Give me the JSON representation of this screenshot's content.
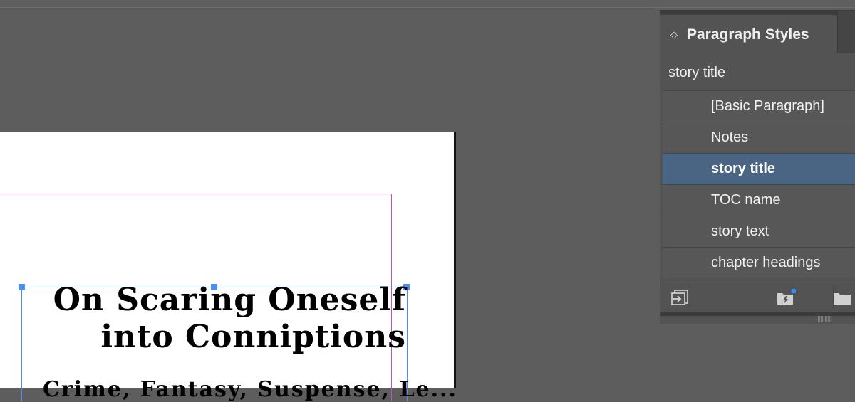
{
  "document": {
    "title_text": "On Scaring Oneself\ninto Conniptions",
    "subtitle_text": "Crime, Fantasy, Suspense, Le..."
  },
  "panel": {
    "title": "Paragraph Styles",
    "current_style": "story title",
    "styles": [
      {
        "label": "[Basic Paragraph]",
        "selected": false
      },
      {
        "label": "Notes",
        "selected": false
      },
      {
        "label": "story title",
        "selected": true
      },
      {
        "label": "TOC name",
        "selected": false
      },
      {
        "label": "story text",
        "selected": false
      },
      {
        "label": "chapter headings",
        "selected": false
      }
    ],
    "footer_icons": [
      "load-styles-icon",
      "new-style-group-quick-apply-icon",
      "new-group-folder-icon"
    ]
  },
  "colors": {
    "selection_blue": "#4e8ef0",
    "margin_guide": "#c04ec4",
    "selected_row": "#4a6584"
  }
}
